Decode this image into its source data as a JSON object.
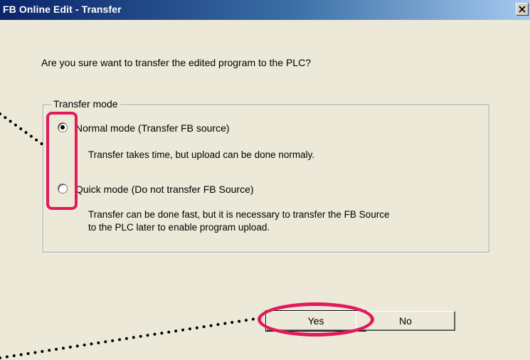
{
  "window": {
    "title": "FB Online Edit - Transfer",
    "close_icon": "close-icon"
  },
  "message": "Are you sure want to transfer the edited program to the PLC?",
  "transfer_mode": {
    "label": "Transfer mode",
    "options": [
      {
        "label": "Normal mode (Transfer FB source)",
        "description": [
          "Transfer takes time, but upload can be done normaly."
        ],
        "selected": true
      },
      {
        "label": "Quick mode (Do not transfer FB Source)",
        "description": [
          "Transfer can be done fast, but it is necessary to transfer the FB Source",
          "to the PLC later to enable program upload."
        ],
        "selected": false
      }
    ]
  },
  "buttons": {
    "yes_label": "Yes",
    "no_label": "No"
  },
  "annotation_color": "#e2195a"
}
